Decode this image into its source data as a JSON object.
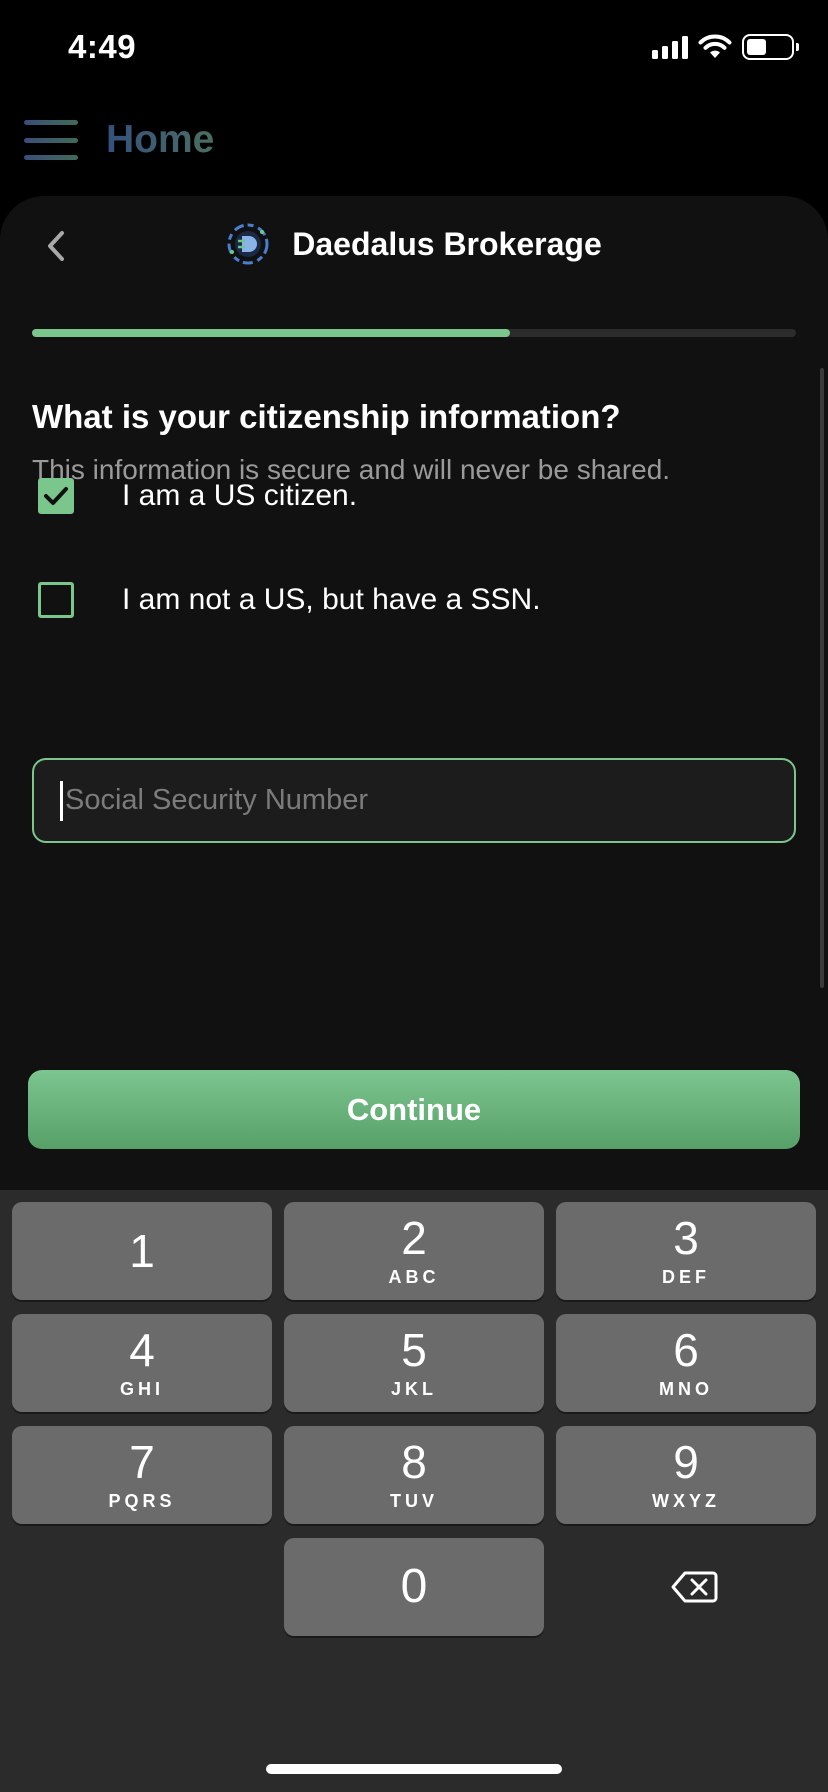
{
  "status_bar": {
    "time": "4:49",
    "battery_level": 0.45
  },
  "app_header": {
    "title": "Home",
    "menu_icon": "hamburger-menu-icon"
  },
  "sheet": {
    "back_icon": "chevron-left-icon",
    "brand_name": "Daedalus Brokerage",
    "progress": 0.625,
    "question": "What is your citizenship information?",
    "subtitle": "This information is secure and will never be shared.",
    "options": [
      {
        "label": "I am a US citizen.",
        "checked": true
      },
      {
        "label": "I am not a US, but have a SSN.",
        "checked": false
      }
    ],
    "ssn_field": {
      "placeholder": "Social Security Number",
      "value": ""
    },
    "continue_label": "Continue",
    "accent_color": "#7ac68c"
  },
  "keyboard": {
    "keys": [
      {
        "num": "1",
        "letters": ""
      },
      {
        "num": "2",
        "letters": "ABC"
      },
      {
        "num": "3",
        "letters": "DEF"
      },
      {
        "num": "4",
        "letters": "GHI"
      },
      {
        "num": "5",
        "letters": "JKL"
      },
      {
        "num": "6",
        "letters": "MNO"
      },
      {
        "num": "7",
        "letters": "PQRS"
      },
      {
        "num": "8",
        "letters": "TUV"
      },
      {
        "num": "9",
        "letters": "WXYZ"
      },
      {
        "num": "0",
        "letters": ""
      }
    ],
    "delete_icon": "backspace-icon"
  }
}
